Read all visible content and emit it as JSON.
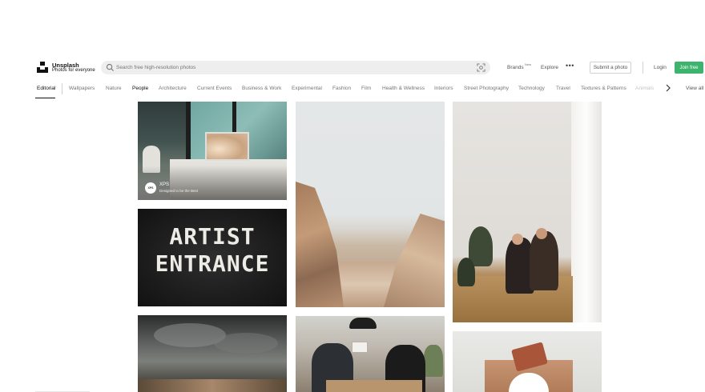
{
  "brand": {
    "name": "Unsplash",
    "tagline": "Photos for everyone"
  },
  "search": {
    "placeholder": "Search free high-resolution photos"
  },
  "header": {
    "brands_label": "Brands",
    "brands_badge": "New",
    "explore_label": "Explore",
    "more_label": "•••",
    "submit_label": "Submit a photo",
    "login_label": "Login",
    "join_label": "Join free"
  },
  "topics": {
    "editorial": "Editorial",
    "items": [
      "Wallpapers",
      "Nature",
      "People",
      "Architecture",
      "Current Events",
      "Business & Work",
      "Experimental",
      "Fashion",
      "Film",
      "Health & Wellness",
      "Interiors",
      "Street Photography",
      "Technology",
      "Travel",
      "Textures & Patterns",
      "Animals"
    ],
    "view_all": "View all"
  },
  "photos": {
    "sponsor_name": "XPS",
    "sponsor_tagline": "Designed to be the Best",
    "sponsor_avatar": "XPS",
    "sign_line1": "ARTIST",
    "sign_line2": "ENTRANCE"
  },
  "colors": {
    "accent": "#3cb46e",
    "text_primary": "#111111",
    "text_muted": "#767676"
  },
  "icons": {
    "search": "search-icon",
    "visual_search": "visual-search-icon",
    "chevron": "chevron-right-icon"
  }
}
